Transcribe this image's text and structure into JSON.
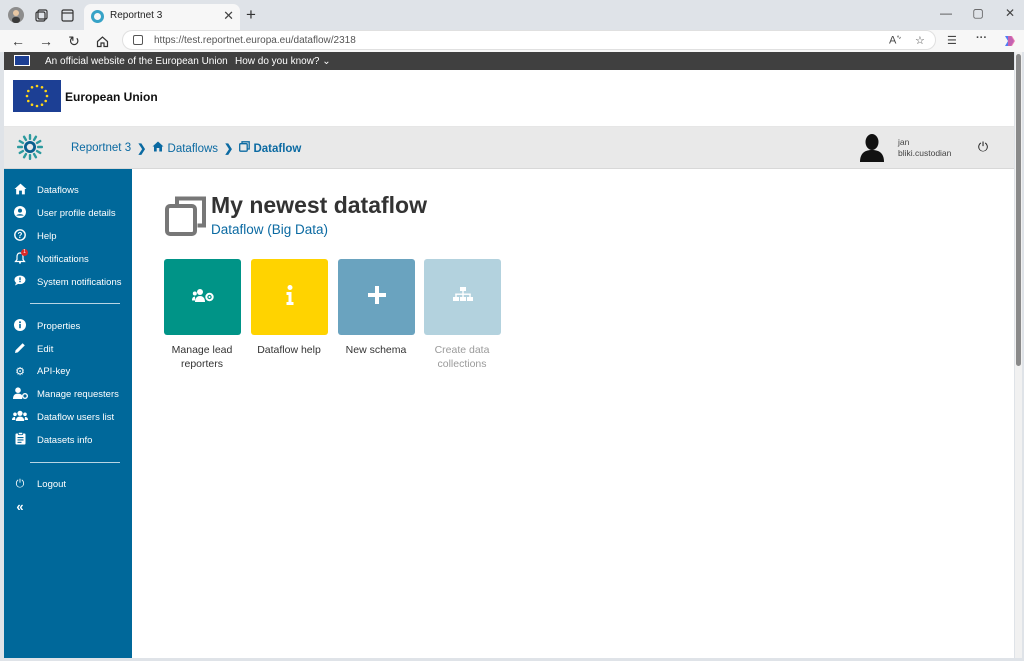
{
  "browser": {
    "tab_title": "Reportnet 3",
    "url": "https://test.reportnet.europa.eu/dataflow/2318"
  },
  "eu_banner": {
    "official_text": "An official website of the European Union",
    "how_know": "How do you know?",
    "org_name": "European Union"
  },
  "app_header": {
    "breadcrumbs": [
      "Reportnet 3",
      "Dataflows",
      "Dataflow"
    ],
    "user": {
      "first_name": "jan",
      "login": "bliki.custodian"
    }
  },
  "sidebar": {
    "nav": [
      {
        "label": "Dataflows",
        "icon": "home-icon"
      },
      {
        "label": "User profile details",
        "icon": "user-circle-icon"
      },
      {
        "label": "Help",
        "icon": "question-icon"
      },
      {
        "label": "Notifications",
        "icon": "bell-icon",
        "badge": "1"
      },
      {
        "label": "System notifications",
        "icon": "comment-icon"
      }
    ],
    "actions": [
      {
        "label": "Properties",
        "icon": "info-icon"
      },
      {
        "label": "Edit",
        "icon": "pencil-icon"
      },
      {
        "label": "API-key",
        "icon": "gear-icon"
      },
      {
        "label": "Manage requesters",
        "icon": "user-gear-icon"
      },
      {
        "label": "Dataflow users list",
        "icon": "users-icon"
      },
      {
        "label": "Datasets info",
        "icon": "clipboard-icon"
      }
    ],
    "logout": "Logout"
  },
  "main": {
    "title": "My newest dataflow",
    "subtitle": "Dataflow (Big Data)",
    "tiles": [
      {
        "label": "Manage lead reporters",
        "color": "#009487",
        "icon": "users-gear-icon",
        "enabled": true
      },
      {
        "label": "Dataflow help",
        "color": "#ffd300",
        "icon": "info-icon",
        "enabled": true
      },
      {
        "label": "New schema",
        "color": "#6aa3bf",
        "icon": "plus-icon",
        "enabled": true
      },
      {
        "label": "Create data collections",
        "color": "#b3d2de",
        "icon": "sitemap-icon",
        "enabled": false
      }
    ]
  },
  "colors": {
    "sidebar_bg": "#00689a",
    "link_blue": "#0b6aa2",
    "eu_blue": "#1c3f94"
  }
}
